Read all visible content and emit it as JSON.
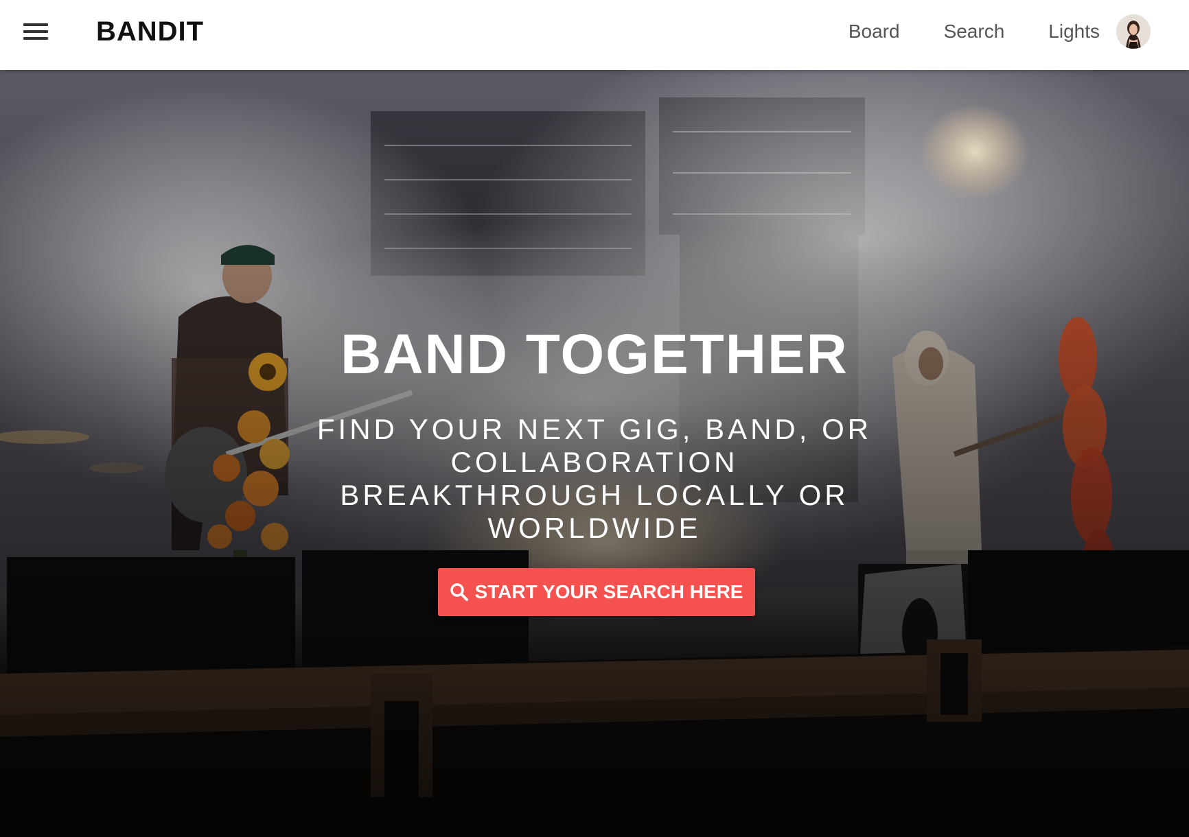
{
  "header": {
    "brand": "BANDIT",
    "nav": [
      {
        "label": "Board"
      },
      {
        "label": "Search"
      },
      {
        "label": "Lights"
      }
    ],
    "menu_icon": "hamburger-menu-icon",
    "avatar_icon": "user-avatar"
  },
  "hero": {
    "title": "BAND TOGETHER",
    "subtitle": "FIND YOUR NEXT GIG, BAND, OR COLLABORATION BREAKTHROUGH LOCALLY OR WORLDWIDE",
    "cta": {
      "label": "START YOUR SEARCH HERE",
      "icon": "search-icon",
      "color": "#f4514f"
    },
    "background": "concert-stage-photo"
  },
  "colors": {
    "header_bg": "#ffffff",
    "brand_text": "#111111",
    "nav_text": "#555555",
    "accent": "#f4514f"
  }
}
